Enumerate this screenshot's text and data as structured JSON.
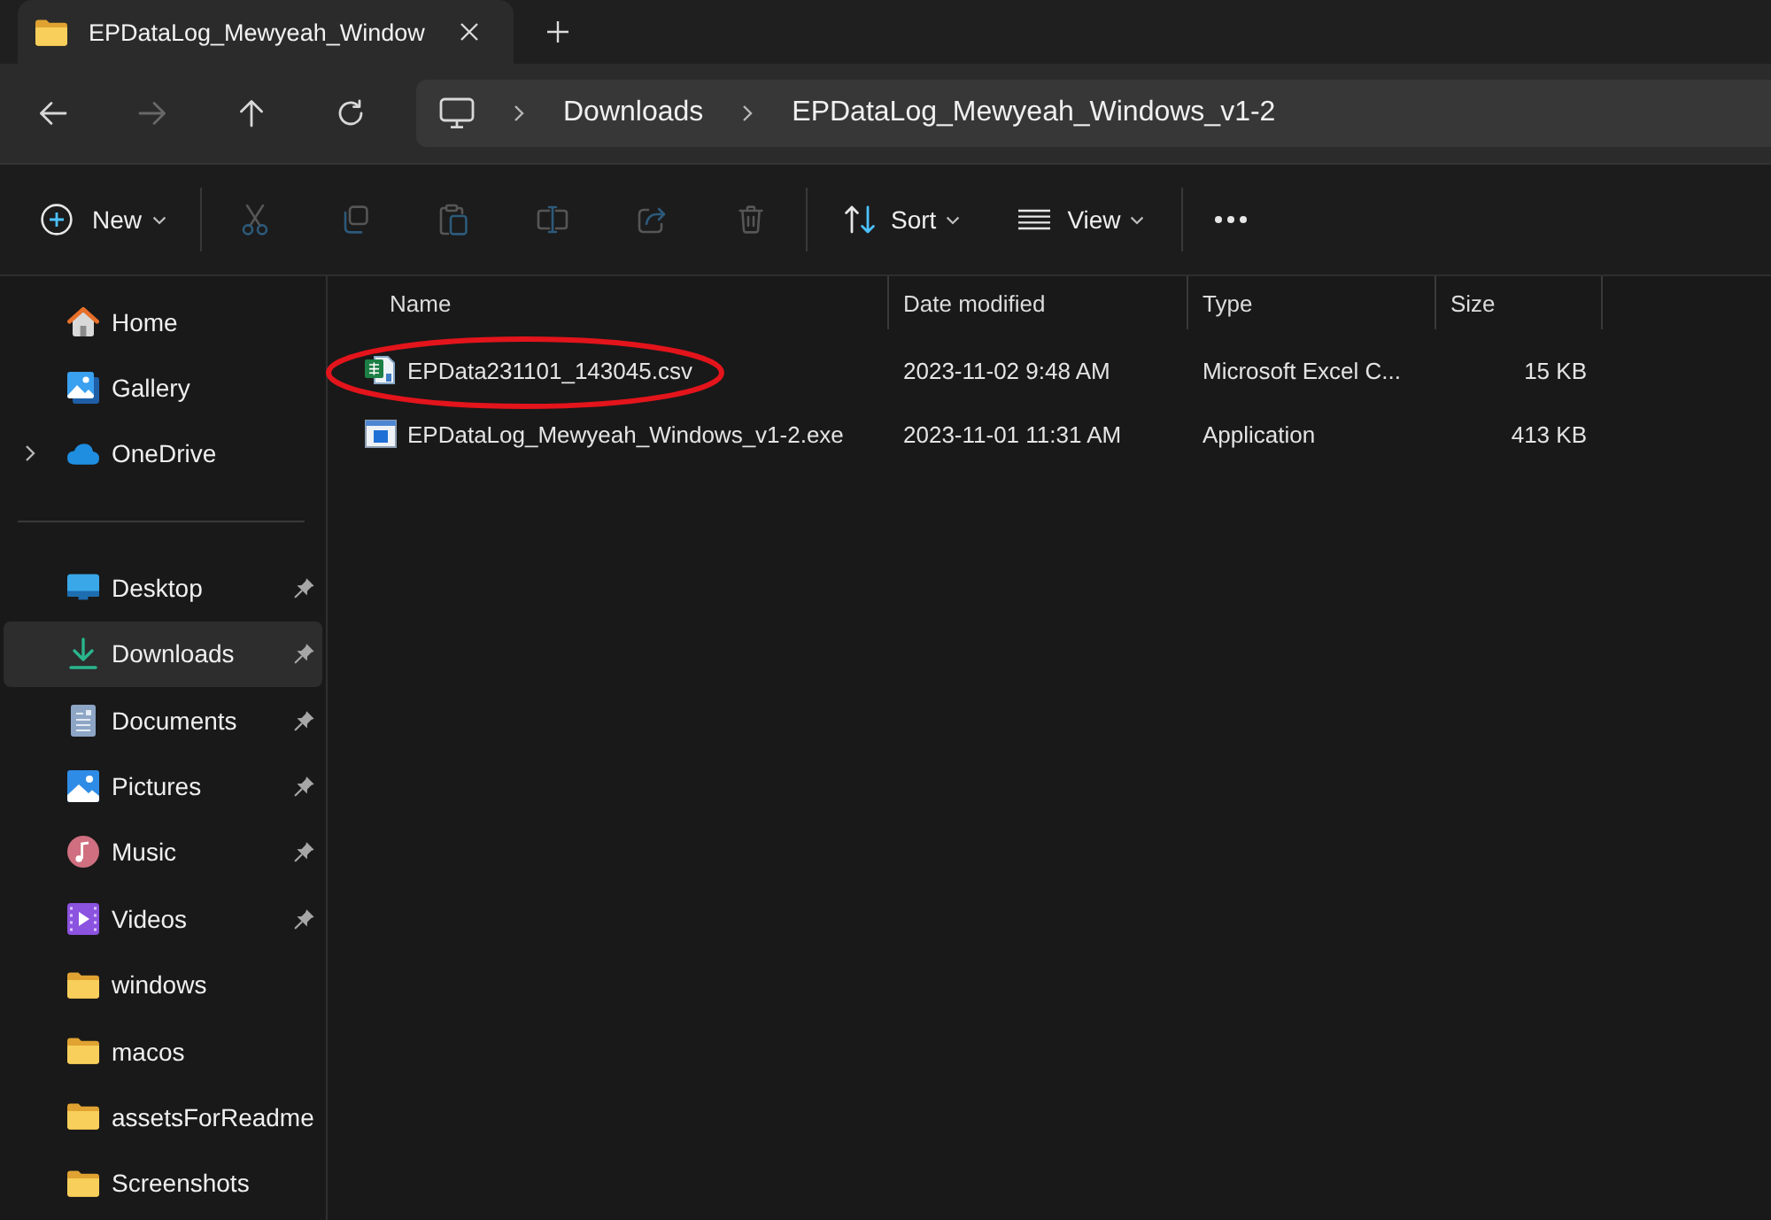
{
  "tabs": [
    {
      "title": "EPDataLog_Mewyeah_Window",
      "selected": true
    }
  ],
  "nav": {
    "buttons": [
      {
        "kind": "back",
        "disabled": false
      },
      {
        "kind": "forward",
        "disabled": true
      },
      {
        "kind": "up",
        "disabled": false
      },
      {
        "kind": "refresh",
        "disabled": false
      }
    ],
    "breadcrumb": [
      "Downloads",
      "EPDataLog_Mewyeah_Windows_v1-2"
    ]
  },
  "toolbar": {
    "new": {
      "label": "New"
    },
    "actions": [
      {
        "kind": "cut",
        "disabled": true
      },
      {
        "kind": "copy",
        "disabled": true
      },
      {
        "kind": "paste",
        "disabled": true
      },
      {
        "kind": "rename",
        "disabled": true
      },
      {
        "kind": "share",
        "disabled": true
      },
      {
        "kind": "delete",
        "disabled": true
      }
    ],
    "sort": {
      "label": "Sort"
    },
    "view": {
      "label": "View"
    }
  },
  "sidebar": {
    "groups": [
      {
        "items": [
          {
            "kind": "home",
            "label": "Home",
            "pinned": false,
            "selected": false
          },
          {
            "kind": "gallery",
            "label": "Gallery",
            "pinned": false,
            "selected": false
          },
          {
            "kind": "cloud",
            "label": "OneDrive",
            "expanded": false,
            "pinned": false,
            "selected": false
          }
        ]
      },
      {
        "items": [
          {
            "kind": "desktop",
            "label": "Desktop",
            "pinned": true,
            "selected": false
          },
          {
            "kind": "downloads",
            "label": "Downloads",
            "pinned": true,
            "selected": true
          },
          {
            "kind": "documents",
            "label": "Documents",
            "pinned": true,
            "selected": false
          },
          {
            "kind": "pictures",
            "label": "Pictures",
            "pinned": true,
            "selected": false
          },
          {
            "kind": "music",
            "label": "Music",
            "pinned": true,
            "selected": false
          },
          {
            "kind": "videos",
            "label": "Videos",
            "pinned": true,
            "selected": false
          },
          {
            "kind": "folder",
            "label": "windows",
            "pinned": false,
            "selected": false
          },
          {
            "kind": "folder",
            "label": "macos",
            "pinned": false,
            "selected": false
          },
          {
            "kind": "folder",
            "label": "assetsForReadme",
            "pinned": false,
            "selected": false
          },
          {
            "kind": "folder",
            "label": "Screenshots",
            "pinned": false,
            "selected": false
          }
        ]
      }
    ]
  },
  "files": {
    "columns": [
      "Name",
      "Date modified",
      "Type",
      "Size"
    ],
    "rows": [
      {
        "kind": "spreadsheet",
        "name": "EPData231101_143045.csv",
        "date_modified": "2023-11-02 9:48 AM",
        "type": "Microsoft Excel C...",
        "size": "15 KB",
        "circled": true
      },
      {
        "kind": "application",
        "name": "EPDataLog_Mewyeah_Windows_v1-2.exe",
        "date_modified": "2023-11-01 11:31 AM",
        "type": "Application",
        "size": "413 KB",
        "circled": false
      }
    ]
  }
}
